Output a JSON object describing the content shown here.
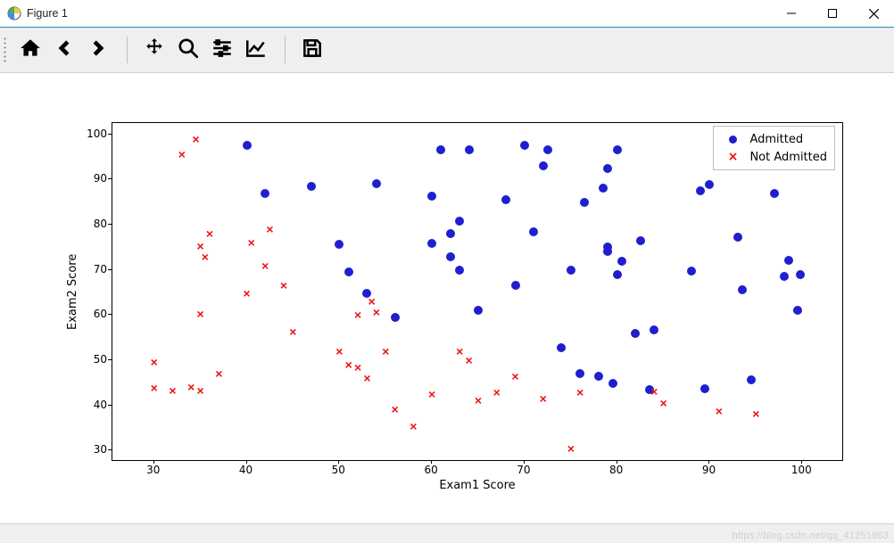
{
  "window": {
    "title": "Figure 1"
  },
  "toolbar": {
    "home": "home-icon",
    "back": "back-icon",
    "forward": "forward-icon",
    "pan": "pan-icon",
    "zoom": "zoom-icon",
    "subplots": "subplots-icon",
    "edit": "edit-icon",
    "save": "save-icon"
  },
  "chart_data": {
    "type": "scatter",
    "xlabel": "Exam1 Score",
    "ylabel": "Exam2 Score",
    "xlim": [
      25.5,
      104.5
    ],
    "ylim": [
      27.5,
      102.5
    ],
    "xticks": [
      30,
      40,
      50,
      60,
      70,
      80,
      90,
      100
    ],
    "yticks": [
      30,
      40,
      50,
      60,
      70,
      80,
      90,
      100
    ],
    "legend": [
      {
        "name": "Admitted",
        "marker": "dot",
        "color": "#1f1fcf"
      },
      {
        "name": "Not Admitted",
        "marker": "cross",
        "color": "#ef1010"
      }
    ],
    "series": [
      {
        "name": "Admitted",
        "marker": "dot",
        "points": [
          [
            40,
            97.5
          ],
          [
            42,
            87
          ],
          [
            47,
            88.5
          ],
          [
            50,
            75.7
          ],
          [
            51,
            69.5
          ],
          [
            53,
            64.8
          ],
          [
            54,
            89
          ],
          [
            56,
            59.5
          ],
          [
            60,
            75.8
          ],
          [
            60,
            86.3
          ],
          [
            61,
            96.5
          ],
          [
            62,
            72.8
          ],
          [
            62,
            78.0
          ],
          [
            63,
            70.0
          ],
          [
            63,
            80.8
          ],
          [
            64,
            96.5
          ],
          [
            65,
            61.0
          ],
          [
            68,
            85.5
          ],
          [
            69,
            66.5
          ],
          [
            70,
            97.5
          ],
          [
            71,
            78.5
          ],
          [
            72,
            93.0
          ],
          [
            72.5,
            96.5
          ],
          [
            74,
            52.8
          ],
          [
            75,
            70.0
          ],
          [
            76,
            47.0
          ],
          [
            76.5,
            85.0
          ],
          [
            78,
            46.5
          ],
          [
            78.5,
            88.0
          ],
          [
            79,
            75.0
          ],
          [
            79,
            92.5
          ],
          [
            79,
            74.0
          ],
          [
            79.5,
            44.8
          ],
          [
            80,
            69.0
          ],
          [
            80,
            96.5
          ],
          [
            80.5,
            72.0
          ],
          [
            82,
            56.0
          ],
          [
            82.5,
            76.5
          ],
          [
            83.5,
            43.5
          ],
          [
            84,
            56.8
          ],
          [
            88,
            69.8
          ],
          [
            89,
            87.5
          ],
          [
            89.5,
            43.7
          ],
          [
            90,
            88.8
          ],
          [
            93,
            77.2
          ],
          [
            93.5,
            65.5
          ],
          [
            94.5,
            45.7
          ],
          [
            97,
            87.0
          ],
          [
            98,
            68.5
          ],
          [
            98.5,
            72.2
          ],
          [
            99.5,
            61.0
          ],
          [
            99.8,
            69.0
          ]
        ]
      },
      {
        "name": "Not Admitted",
        "marker": "cross",
        "points": [
          [
            30,
            43.8
          ],
          [
            30,
            49.6
          ],
          [
            32,
            43.3
          ],
          [
            33,
            95.5
          ],
          [
            34,
            44.0
          ],
          [
            34.5,
            99.0
          ],
          [
            35,
            75.3
          ],
          [
            35,
            60.3
          ],
          [
            35,
            43.3
          ],
          [
            35.5,
            72.8
          ],
          [
            36,
            78.0
          ],
          [
            37,
            47.0
          ],
          [
            40,
            64.8
          ],
          [
            40.5,
            76.0
          ],
          [
            42,
            71.0
          ],
          [
            42.5,
            79.0
          ],
          [
            44,
            66.5
          ],
          [
            45,
            56.3
          ],
          [
            50,
            52.0
          ],
          [
            51,
            49.0
          ],
          [
            52,
            48.5
          ],
          [
            52,
            60.0
          ],
          [
            53,
            46.0
          ],
          [
            53.5,
            63.0
          ],
          [
            54,
            60.7
          ],
          [
            55,
            52.0
          ],
          [
            56,
            39.2
          ],
          [
            58,
            35.3
          ],
          [
            60,
            42.5
          ],
          [
            63,
            52.0
          ],
          [
            64,
            50.0
          ],
          [
            65,
            41.2
          ],
          [
            67,
            42.8
          ],
          [
            69,
            46.5
          ],
          [
            72,
            41.5
          ],
          [
            75,
            30.5
          ],
          [
            76,
            42.8
          ],
          [
            84,
            43.0
          ],
          [
            85,
            40.5
          ],
          [
            91,
            38.7
          ],
          [
            95,
            38.2
          ]
        ]
      }
    ]
  },
  "watermark": "https://blog.csdn.net/qq_41251963"
}
